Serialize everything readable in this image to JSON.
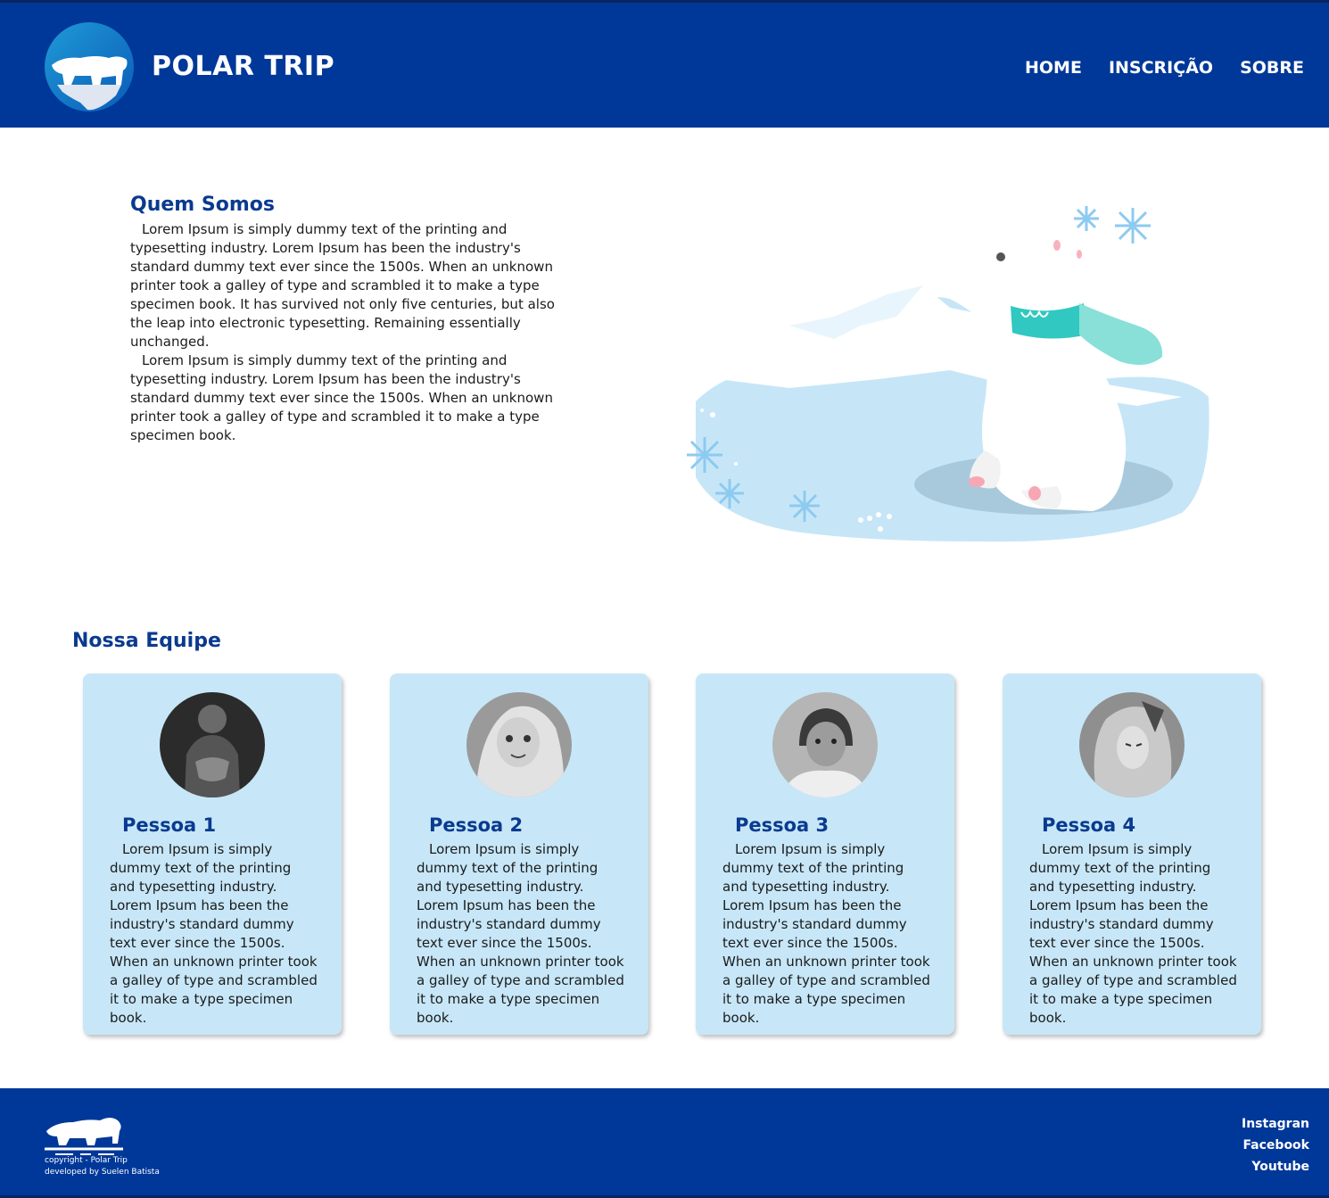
{
  "header": {
    "brand": "POLAR TRIP",
    "nav": [
      "HOME",
      "INSCRIÇÃO",
      "SOBRE"
    ]
  },
  "about": {
    "title": "Quem Somos",
    "paragraphs": [
      "Lorem Ipsum is simply dummy text of the printing and typesetting industry. Lorem Ipsum has been the industry's standard dummy text ever since the 1500s. When an unknown printer took a galley of type and scrambled it to make a type specimen book. It has survived not only five centuries, but also the leap into electronic typesetting. Remaining essentially unchanged.",
      "Lorem Ipsum is simply dummy text of the printing and typesetting industry. Lorem Ipsum has been the industry's standard dummy text ever since the 1500s. When an unknown printer took a galley of type and scrambled it to make a type specimen book."
    ]
  },
  "team": {
    "title": "Nossa Equipe",
    "members": [
      {
        "name": "Pessoa 1",
        "text": "Lorem Ipsum is simply dummy text of the printing and typesetting industry. Lorem Ipsum has been the industry's standard dummy text ever since the 1500s. When an unknown printer took a galley of type and scrambled it to make a type specimen book."
      },
      {
        "name": "Pessoa 2",
        "text": "Lorem Ipsum is simply dummy text of the printing and typesetting industry. Lorem Ipsum has been the industry's standard dummy text ever since the 1500s. When an unknown printer took a galley of type and scrambled it to make a type specimen book."
      },
      {
        "name": "Pessoa 3",
        "text": "Lorem Ipsum is simply dummy text of the printing and typesetting industry. Lorem Ipsum has been the industry's standard dummy text ever since the 1500s. When an unknown printer took a galley of type and scrambled it to make a type specimen book."
      },
      {
        "name": "Pessoa 4",
        "text": "Lorem Ipsum is simply dummy text of the printing and typesetting industry. Lorem Ipsum has been the industry's standard dummy text ever since the 1500s. When an unknown printer took a galley of type and scrambled it to make a type specimen book."
      }
    ]
  },
  "footer": {
    "copyright": "copyright - Polar Trip",
    "developer": "developed by Suelen Batista",
    "social": [
      "Instagran",
      "Facebook",
      "Youtube"
    ]
  },
  "colors": {
    "primary": "#003899",
    "heading": "#0a3a8f",
    "card": "#c7e7f8"
  },
  "icons": {
    "logo": "polar-bear-logo-icon",
    "footer_logo": "polar-bear-silhouette-icon",
    "illustration": "polar-bear-scarf-illustration"
  }
}
